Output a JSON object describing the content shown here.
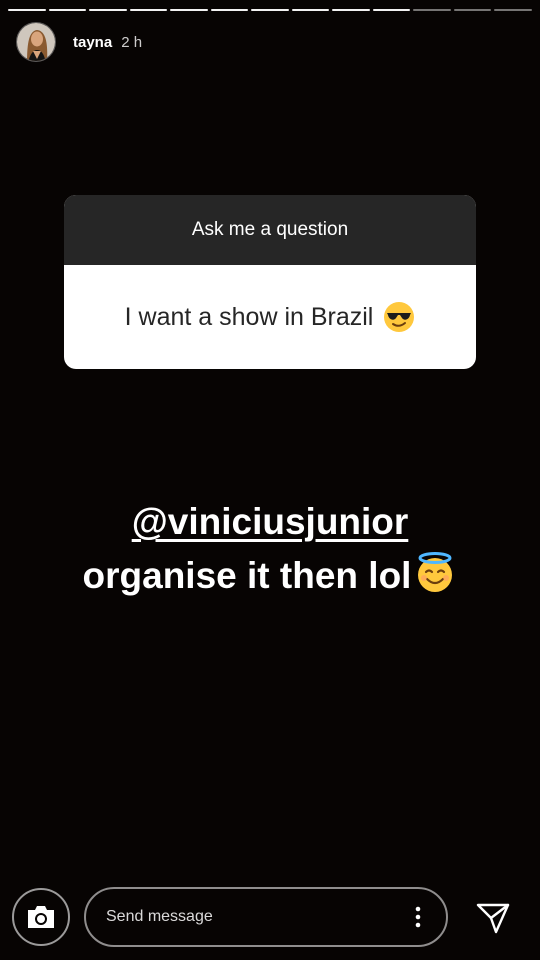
{
  "story": {
    "progress_segments": {
      "total": 13,
      "viewed": 10
    }
  },
  "header": {
    "username": "tayna",
    "time": "2 h"
  },
  "question_sticker": {
    "title": "Ask me a question",
    "answer": "I want a show in Brazil",
    "answer_emoji": "sunglasses-face"
  },
  "caption": {
    "mention": "@viniciusjunior",
    "text": "organise it then lol",
    "emoji": "halo-face"
  },
  "footer": {
    "message_placeholder": "Send message",
    "icons": [
      "camera-icon",
      "more-vertical-icon",
      "send-icon"
    ]
  }
}
